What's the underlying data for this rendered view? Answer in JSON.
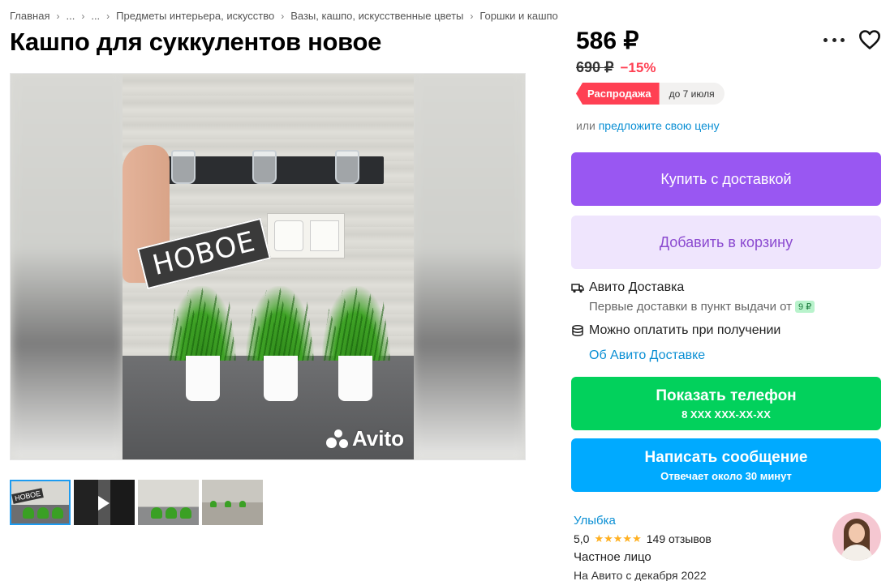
{
  "breadcrumbs": [
    "Главная",
    "...",
    "...",
    "Предметы интерьера, искусство",
    "Вазы, кашпо, искусственные цветы",
    "Горшки и кашпо"
  ],
  "title": "Кашпо для суккулентов новое",
  "gallery": {
    "stamp_text": "НОВОЕ",
    "watermark": "Avito",
    "thumbnails": [
      "photo-1",
      "video-2",
      "photo-3",
      "photo-4"
    ],
    "thumb_label": "НОВОЕ"
  },
  "price": {
    "current": "586 ₽",
    "old": "690 ₽",
    "discount": "−15%"
  },
  "badges": {
    "sale": "Распродажа",
    "until": "до 7 июля"
  },
  "offer": {
    "prefix": "или",
    "link": "предложите свою цену"
  },
  "buttons": {
    "buy": "Купить с доставкой",
    "cart": "Добавить в корзину",
    "phone_main": "Показать телефон",
    "phone_sub": "8 XXX XXX-XX-XX",
    "message_main": "Написать сообщение",
    "message_sub": "Отвечает около 30 минут"
  },
  "delivery": {
    "title": "Авито Доставка",
    "subtitle": "Первые доставки в пункт выдачи от",
    "price_pill": "9 ₽",
    "pay_on_receipt": "Можно оплатить при получении",
    "about_link": "Об Авито Доставке"
  },
  "seller": {
    "name": "Улыбка",
    "rating": "5,0",
    "stars": "★★★★★",
    "reviews": "149 отзывов",
    "type": "Частное лицо",
    "since": "На Авито с декабря 2022"
  },
  "icons": {
    "more": "more-icon",
    "favorite": "heart-icon",
    "delivery": "truck-icon",
    "payment": "coins-icon",
    "play": "play-icon"
  },
  "colors": {
    "buy": "#9957f2",
    "cart_bg": "#efe5fd",
    "phone": "#02d15c",
    "message": "#00aaff",
    "sale": "#ff4053",
    "link": "#0a8fd4"
  }
}
